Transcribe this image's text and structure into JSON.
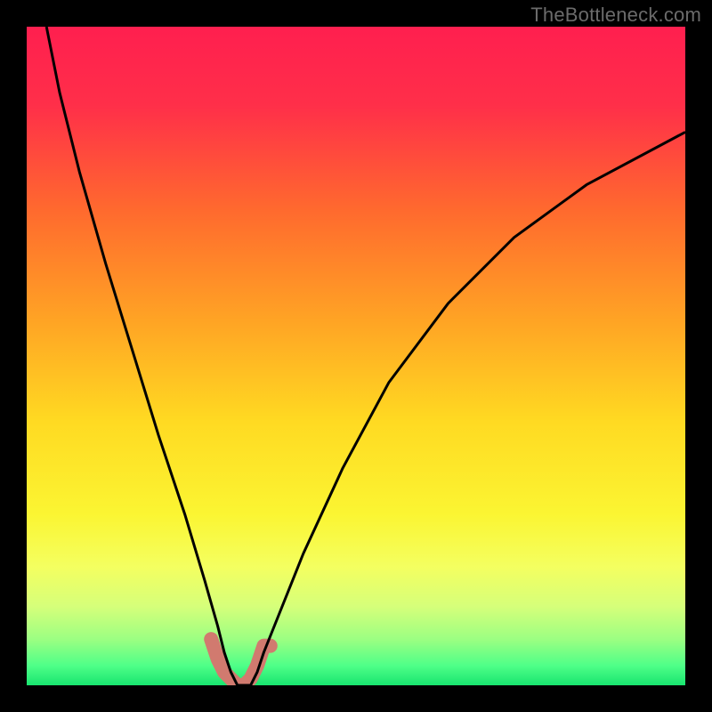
{
  "watermark": "TheBottleneck.com",
  "chart_data": {
    "type": "line",
    "title": "",
    "xlabel": "",
    "ylabel": "",
    "xlim": [
      0,
      100
    ],
    "ylim": [
      0,
      100
    ],
    "series": [
      {
        "name": "bottleneck-curve",
        "x": [
          3,
          5,
          8,
          12,
          16,
          20,
          24,
          27,
          29,
          30,
          31,
          32,
          33,
          34,
          35,
          36,
          38,
          42,
          48,
          55,
          64,
          74,
          85,
          100
        ],
        "y": [
          100,
          90,
          78,
          64,
          51,
          38,
          26,
          16,
          9,
          5,
          2,
          0,
          0,
          0,
          2,
          5,
          10,
          20,
          33,
          46,
          58,
          68,
          76,
          84
        ]
      },
      {
        "name": "valley-marker",
        "x": [
          28,
          29,
          30,
          31,
          32,
          33,
          34,
          35,
          36,
          37
        ],
        "y": [
          7,
          4,
          2,
          1,
          0,
          0,
          1,
          3,
          6,
          6
        ]
      }
    ],
    "gradient_stops": [
      {
        "pos": 0.0,
        "color": "#ff1f4f"
      },
      {
        "pos": 0.12,
        "color": "#ff2f49"
      },
      {
        "pos": 0.28,
        "color": "#ff6a2e"
      },
      {
        "pos": 0.45,
        "color": "#ffa524"
      },
      {
        "pos": 0.6,
        "color": "#ffda22"
      },
      {
        "pos": 0.74,
        "color": "#fbf532"
      },
      {
        "pos": 0.82,
        "color": "#f4ff60"
      },
      {
        "pos": 0.88,
        "color": "#d6ff7a"
      },
      {
        "pos": 0.93,
        "color": "#9cff82"
      },
      {
        "pos": 0.97,
        "color": "#4fff88"
      },
      {
        "pos": 1.0,
        "color": "#18e56f"
      }
    ],
    "curve_style": {
      "stroke": "#000000",
      "width": 3
    },
    "marker_style": {
      "stroke": "#d17a6f",
      "width": 16,
      "cap": "round"
    }
  }
}
